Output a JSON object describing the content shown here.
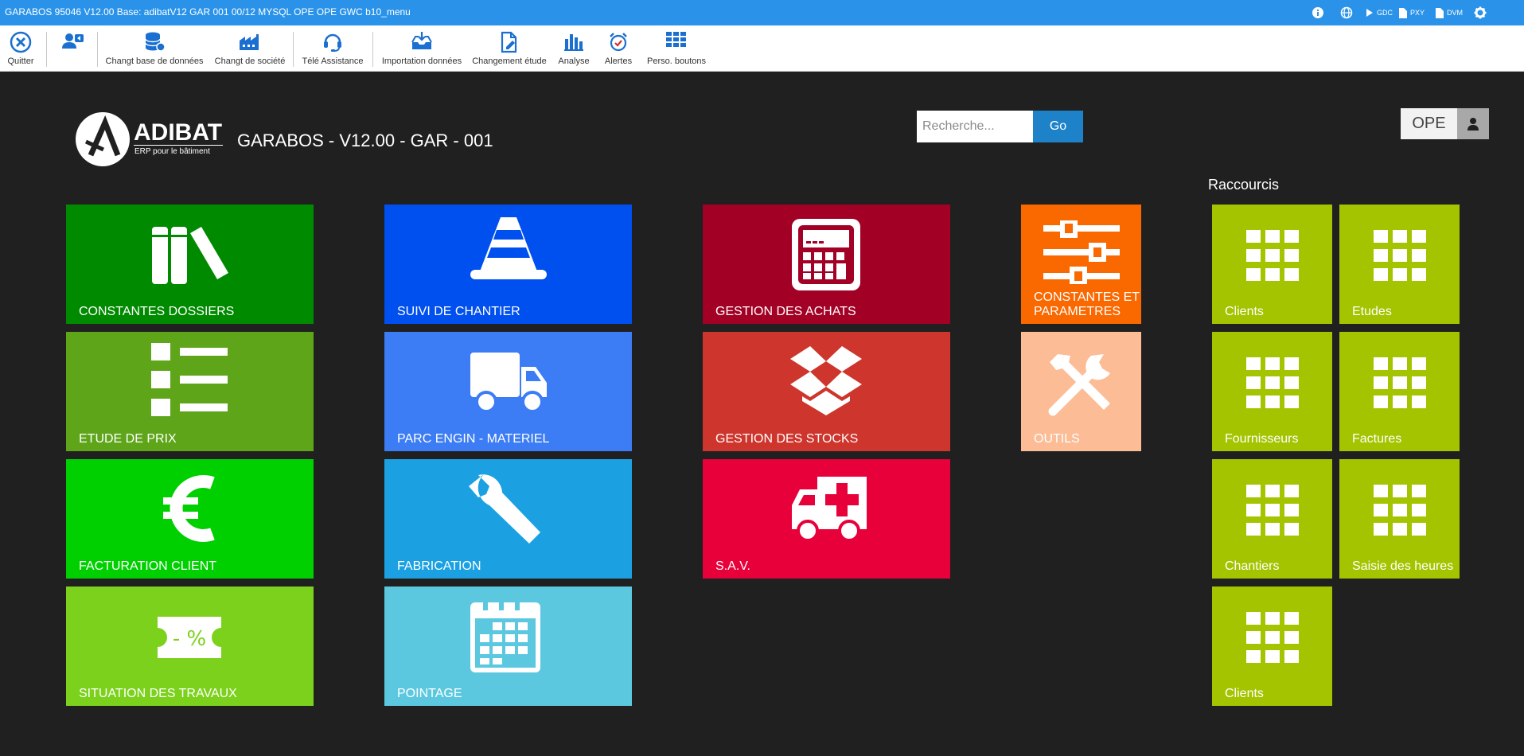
{
  "window": {
    "title": "GARABOS 95046 V12.00 Base: adibatV12 GAR 001 00/12 MYSQL OPE OPE GWC b10_menu",
    "right_items": [
      {
        "name": "info-icon",
        "label": ""
      },
      {
        "name": "globe-icon",
        "label": ""
      },
      {
        "name": "gdc",
        "label": "GDC"
      },
      {
        "name": "pxy",
        "label": "PXY"
      },
      {
        "name": "dvm",
        "label": "DVM"
      },
      {
        "name": "gear-icon",
        "label": ""
      }
    ]
  },
  "toolbar": {
    "quit": "Quitter",
    "change_db": "Changt base de données",
    "change_company": "Changt de société",
    "remote_assist": "Télé Assistance",
    "import": "Importation données",
    "change_study": "Changement étude",
    "analysis": "Analyse",
    "alerts": "Alertes",
    "custom_buttons": "Perso. boutons"
  },
  "header": {
    "brand": "ADIBAT",
    "brand_sub": "ERP pour le bâtiment",
    "app_title": "GARABOS - V12.00 - GAR - 001",
    "search_placeholder": "Recherche...",
    "go_label": "Go",
    "user": "OPE"
  },
  "tiles": {
    "constantes_dossiers": "CONSTANTES DOSSIERS",
    "etude_prix": "ETUDE DE PRIX",
    "facturation_client": "FACTURATION CLIENT",
    "situation_travaux": "SITUATION DES TRAVAUX",
    "suivi_chantier": "SUIVI DE CHANTIER",
    "parc_engin": "PARC ENGIN - MATERIEL",
    "fabrication": "FABRICATION",
    "pointage": "POINTAGE",
    "gestion_achats": "GESTION DES ACHATS",
    "gestion_stocks": "GESTION DES STOCKS",
    "sav": "S.A.V.",
    "constantes_parametres": "CONSTANTES ET PARAMETRES",
    "outils": "OUTILS",
    "situation_badge": "- %"
  },
  "shortcuts": {
    "title": "Raccourcis",
    "items": [
      "Clients",
      "Etudes",
      "Fournisseurs",
      "Factures",
      "Chantiers",
      "Saisie des heures",
      "Clients"
    ]
  },
  "colors": {
    "titlebar": "#2a93e9",
    "background": "#202020",
    "constantes_dossiers": "#008a00",
    "etude_prix": "#5ea51a",
    "facturation_client": "#00d000",
    "situation_travaux": "#7bd11c",
    "suivi_chantier": "#0050ef",
    "parc_engin": "#3c7df5",
    "fabrication": "#1ba1e2",
    "pointage": "#5bc8e0",
    "gestion_achats": "#a20025",
    "gestion_stocks": "#ce352c",
    "sav": "#e8003a",
    "constantes_parametres": "#fa6800",
    "outils": "#fbbc96",
    "shortcut": "#a4c400",
    "go_button": "#1e82c8"
  }
}
